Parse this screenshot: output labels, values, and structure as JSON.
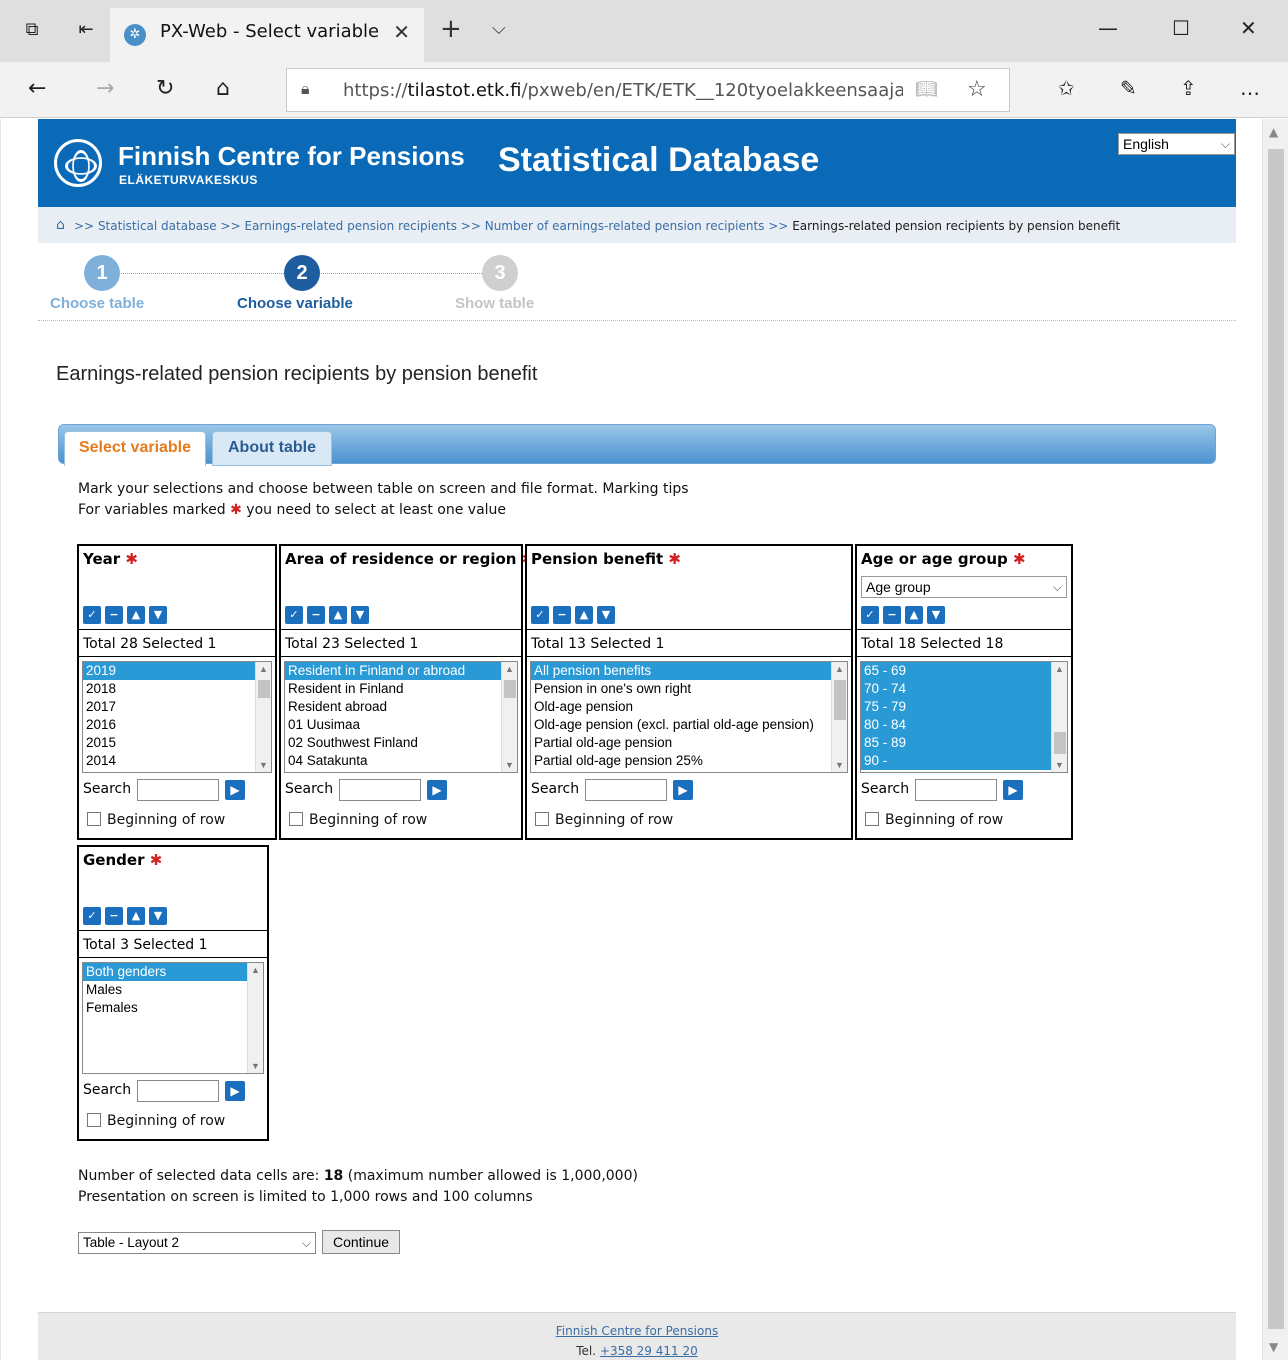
{
  "browser": {
    "tab_title": "PX-Web - Select variable",
    "url_prefix": "https://",
    "url_host": "tilastot.etk.fi",
    "url_path": "/pxweb/en/ETK/ETK__120tyoelakkeensaaja"
  },
  "header": {
    "org_name": "Finnish Centre for Pensions",
    "org_subname": "ELÄKETURVAKESKUS",
    "db_title": "Statistical Database",
    "language": "English"
  },
  "breadcrumb": {
    "sep": ">>",
    "items": [
      "Statistical database",
      "Earnings-related pension recipients",
      "Number of earnings-related pension recipients"
    ],
    "current": "Earnings-related pension recipients by pension benefit"
  },
  "steps": [
    {
      "num": "1",
      "label": "Choose table"
    },
    {
      "num": "2",
      "label": "Choose variable"
    },
    {
      "num": "3",
      "label": "Show table"
    }
  ],
  "table_title": "Earnings-related pension recipients by pension benefit",
  "tabs": {
    "select": "Select variable",
    "about": "About table"
  },
  "info": {
    "line1": "Mark your selections and choose between table on screen and file format. Marking tips",
    "line2_pre": "For variables marked",
    "line2_post": "you need to select at least one value",
    "star": "✱"
  },
  "common": {
    "search_label": "Search",
    "beginning_label": "Beginning of row"
  },
  "variables": [
    {
      "name": "Year",
      "total": "Total 28 Selected 1",
      "items": [
        "2019",
        "2018",
        "2017",
        "2016",
        "2015",
        "2014"
      ],
      "selected": [
        true,
        false,
        false,
        false,
        false,
        false
      ]
    },
    {
      "name": "Area of residence or region",
      "total": "Total 23 Selected 1",
      "items": [
        "Resident in Finland or abroad",
        "Resident in Finland",
        "Resident abroad",
        "01 Uusimaa",
        "02 Southwest Finland",
        "04 Satakunta"
      ],
      "selected": [
        true,
        false,
        false,
        false,
        false,
        false
      ]
    },
    {
      "name": "Pension benefit",
      "total": "Total 13 Selected 1",
      "items": [
        "All pension benefits",
        "Pension in one's own right",
        "Old-age pension",
        "Old-age pension (excl. partial old-age pension)",
        "Partial old-age pension",
        "Partial old-age pension 25%"
      ],
      "selected": [
        true,
        false,
        false,
        false,
        false,
        false
      ]
    },
    {
      "name": "Age or age group",
      "dropdown": "Age group",
      "total": "Total 18 Selected 18",
      "items": [
        "65 - 69",
        "70 - 74",
        "75 - 79",
        "80 - 84",
        "85 - 89",
        "90 -"
      ],
      "selected": [
        true,
        true,
        true,
        true,
        true,
        true
      ]
    },
    {
      "name": "Gender",
      "total": "Total 3 Selected 1",
      "items": [
        "Both genders",
        "Males",
        "Females"
      ],
      "selected": [
        true,
        false,
        false
      ]
    }
  ],
  "summary": {
    "cells_pre": "Number of selected data cells are:",
    "cells_count": "18",
    "cells_post": "(maximum number allowed is 1,000,000)",
    "limit": "Presentation on screen is limited to 1,000 rows and 100 columns"
  },
  "presentation": {
    "selected": "Table - Layout 2",
    "continue": "Continue"
  },
  "footer": {
    "org": "Finnish Centre for Pensions",
    "tel_label": "Tel.",
    "tel": "+358 29 411 20"
  },
  "colors": {
    "brand_blue": "#0a6ab8",
    "selection": "#2a9ad6",
    "tab_active": "#e57b1e",
    "required": "#d32020"
  }
}
